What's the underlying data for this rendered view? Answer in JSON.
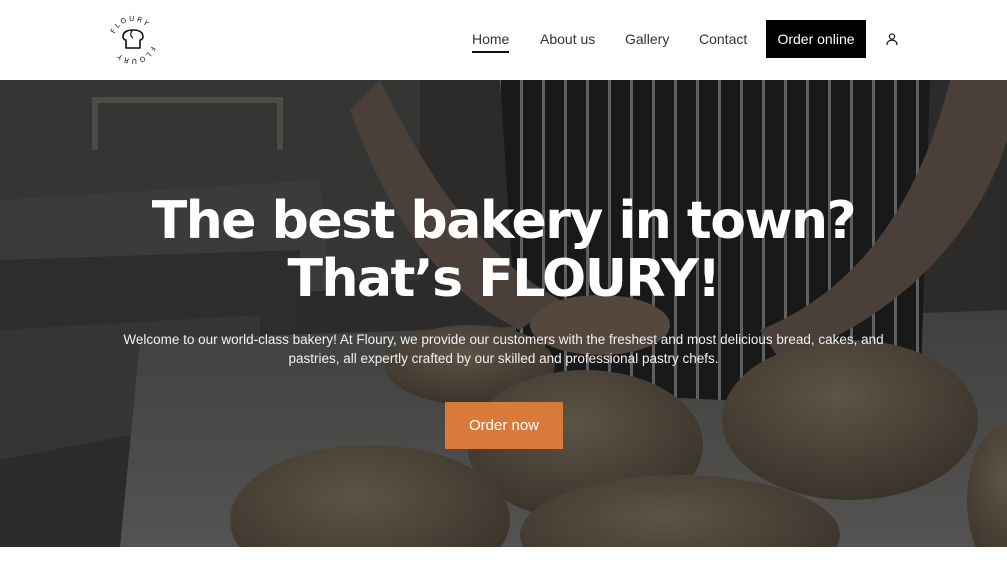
{
  "brand": {
    "logo_ring_text": "FLOURY FLOURY",
    "logo_icon": "bread-icon"
  },
  "nav": {
    "items": [
      {
        "label": "Home",
        "active": true
      },
      {
        "label": "About us",
        "active": false
      },
      {
        "label": "Gallery",
        "active": false
      },
      {
        "label": "Contact",
        "active": false
      }
    ],
    "order_online_label": "Order online",
    "account_icon": "user-icon"
  },
  "hero": {
    "title_line1": "The best bakery in town?",
    "title_line2": "That’s FLOURY!",
    "description": "Welcome to our world-class bakery! At Floury, we provide our customers with the freshest and most delicious bread, cakes, and pastries, all expertly crafted by our skilled and professional pastry chefs.",
    "cta_label": "Order now"
  },
  "colors": {
    "accent": "#d97a3a",
    "header_bg": "#ffffff",
    "order_online_bg": "#000000"
  }
}
